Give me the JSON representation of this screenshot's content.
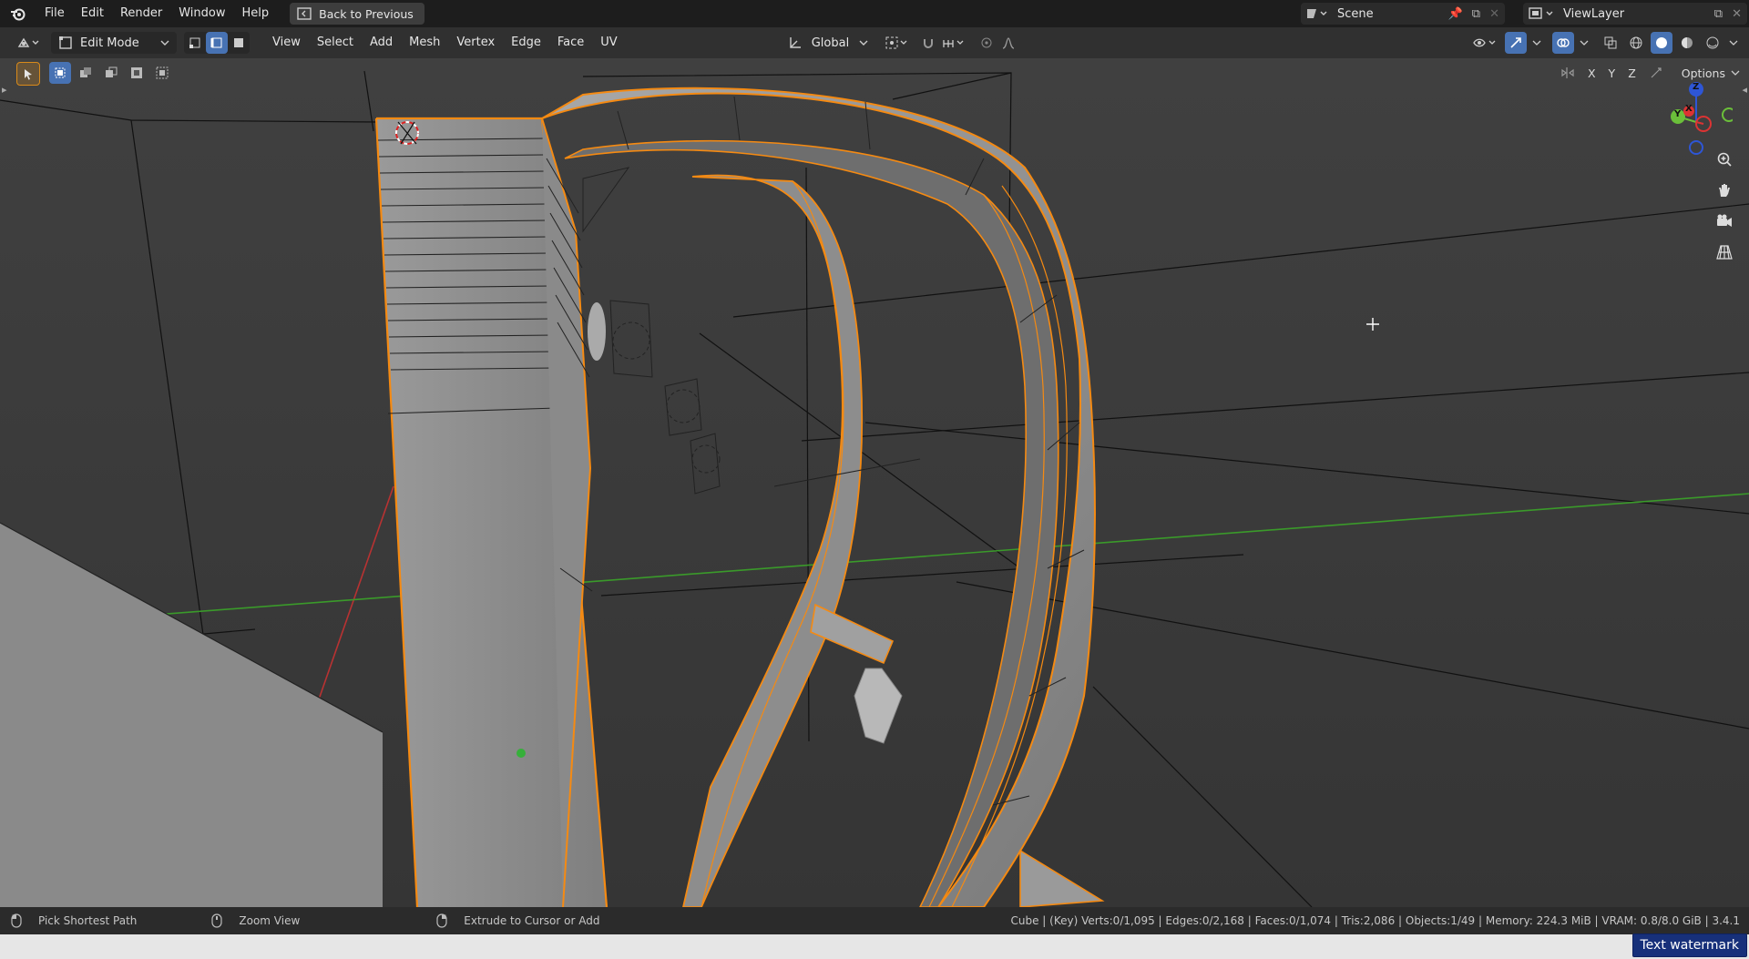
{
  "topbar": {
    "menus": [
      "File",
      "Edit",
      "Render",
      "Window",
      "Help"
    ],
    "back_label": "Back to Previous",
    "scene": "Scene",
    "view_layer": "ViewLayer"
  },
  "header": {
    "mode": "Edit Mode",
    "menus": [
      "View",
      "Select",
      "Add",
      "Mesh",
      "Vertex",
      "Edge",
      "Face",
      "UV"
    ],
    "orientation": "Global",
    "axes": [
      "X",
      "Y",
      "Z"
    ],
    "options_label": "Options"
  },
  "gizmo": {
    "z": "Z",
    "y": "Y",
    "x": "X"
  },
  "status": {
    "hint1": "Pick Shortest Path",
    "hint2": "Zoom View",
    "hint3": "Extrude to Cursor or Add",
    "stats": "Cube | (Key) Verts:0/1,095 | Edges:0/2,168 | Faces:0/1,074 | Tris:2,086 | Objects:1/49 | Memory: 224.3 MiB | VRAM: 0.8/8.0 GiB | 3.4.1"
  },
  "watermark": "Text watermark",
  "colors": {
    "select_orange": "#f58a12",
    "x_axis_red": "#b83232",
    "y_axis_green": "#3a9a2a",
    "active_blue": "#4772b3"
  }
}
